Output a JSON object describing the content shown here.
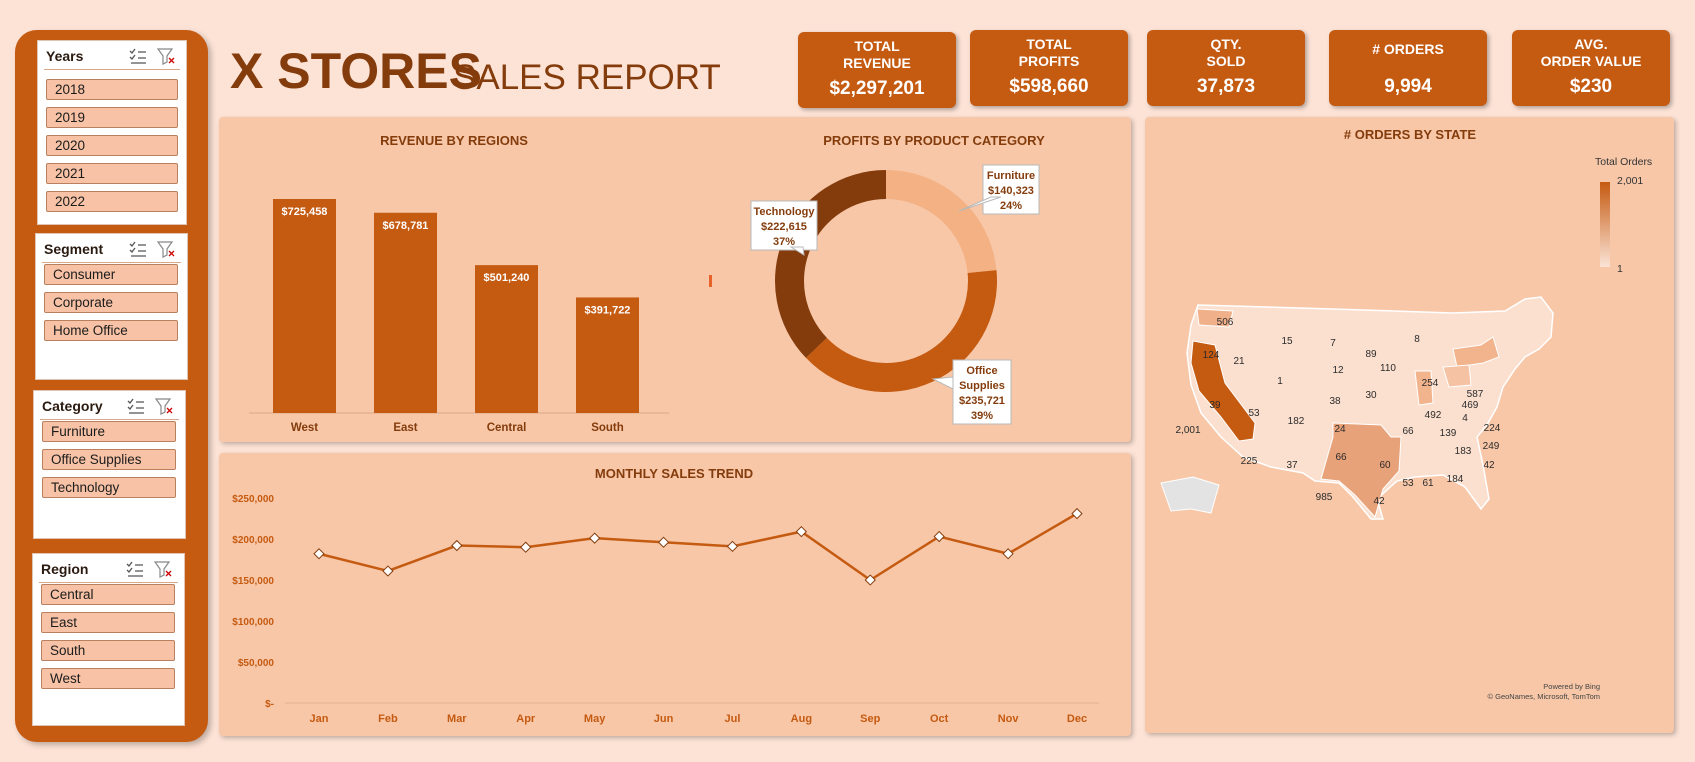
{
  "report": {
    "title_main": "X STORES",
    "title_sub": "SALES REPORT"
  },
  "slicers": {
    "years": {
      "title": "Years",
      "items": [
        "2018",
        "2019",
        "2020",
        "2021",
        "2022"
      ]
    },
    "segment": {
      "title": "Segment",
      "items": [
        "Consumer",
        "Corporate",
        "Home Office"
      ]
    },
    "category": {
      "title": "Category",
      "items": [
        "Furniture",
        "Office Supplies",
        "Technology"
      ]
    },
    "region": {
      "title": "Region",
      "items": [
        "Central",
        "East",
        "South",
        "West"
      ]
    }
  },
  "kpis": [
    {
      "label": "TOTAL\nREVENUE",
      "value": "$2,297,201"
    },
    {
      "label": "TOTAL\nPROFITS",
      "value": "$598,660"
    },
    {
      "label": "QTY.\nSOLD",
      "value": "37,873"
    },
    {
      "label": "# ORDERS",
      "value": "9,994"
    },
    {
      "label": "AVG.\nORDER VALUE",
      "value": "$230"
    }
  ],
  "map": {
    "title": "# ORDERS BY STATE",
    "legend_title": "Total Orders",
    "legend_max": "2,001",
    "legend_min": "1",
    "credit_1": "Powered by Bing",
    "credit_2": "© GeoNames, Microsoft, TomTom",
    "labels": [
      "506",
      "124",
      "21",
      "15",
      "7",
      "89",
      "8",
      "110",
      "254",
      "587",
      "1",
      "12",
      "39",
      "53",
      "38",
      "30",
      "492",
      "469",
      "2,001",
      "182",
      "24",
      "66",
      "139",
      "4",
      "224",
      "183",
      "249",
      "225",
      "37",
      "66",
      "60",
      "42",
      "985",
      "53",
      "61",
      "184",
      "42"
    ]
  },
  "colors": {
    "accent": "#c55a11",
    "dark": "#843c0c",
    "panel": "#f7c7a8",
    "background": "#fde3d6"
  },
  "chart_data": [
    {
      "type": "bar",
      "title": "REVENUE BY REGIONS",
      "categories": [
        "West",
        "East",
        "Central",
        "South"
      ],
      "values": [
        725458,
        678781,
        501240,
        391722
      ],
      "data_labels": [
        "$725,458",
        "$678,781",
        "$501,240",
        "$391,722"
      ],
      "ylim": [
        0,
        800000
      ]
    },
    {
      "type": "pie",
      "title": "PROFITS BY PRODUCT CATEGORY",
      "slices": [
        {
          "name": "Furniture",
          "value": 140323,
          "value_label": "$140,323",
          "percent": "24%",
          "color": "#f4b183"
        },
        {
          "name": "Office Supplies",
          "value": 235721,
          "value_label": "$235,721",
          "percent": "39%",
          "color": "#c55a11"
        },
        {
          "name": "Technology",
          "value": 222615,
          "value_label": "$222,615",
          "percent": "37%",
          "color": "#843c0c"
        }
      ]
    },
    {
      "type": "line",
      "title": "MONTHLY SALES TREND",
      "x": [
        "Jan",
        "Feb",
        "Mar",
        "Apr",
        "May",
        "Jun",
        "Jul",
        "Aug",
        "Sep",
        "Oct",
        "Nov",
        "Dec"
      ],
      "values": [
        182000,
        161000,
        192000,
        190000,
        201000,
        196000,
        191000,
        209000,
        150000,
        203000,
        182000,
        231000
      ],
      "yticks": [
        "$250,000",
        "$200,000",
        "$150,000",
        "$100,000",
        "$50,000",
        "$-"
      ],
      "ylim": [
        0,
        250000
      ]
    }
  ]
}
